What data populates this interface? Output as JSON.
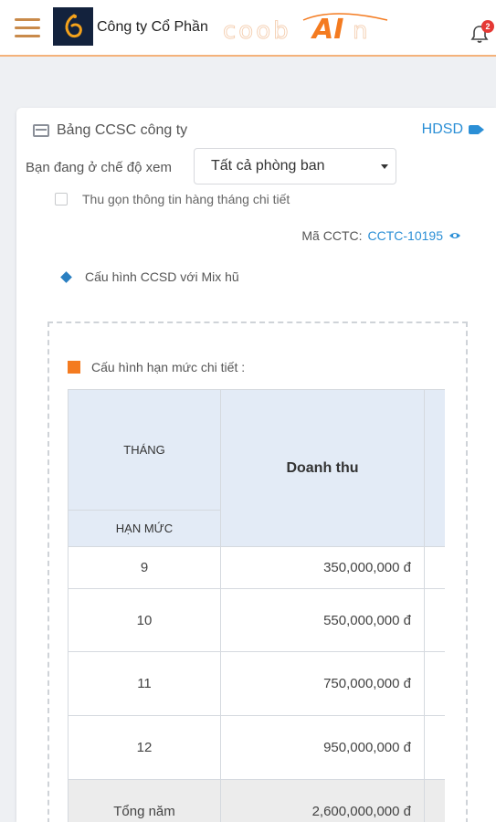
{
  "header": {
    "company_name": "Công ty Cổ Phần",
    "brand_text": "COOBAI",
    "notification_count": "2",
    "accent": "#f47b20"
  },
  "card": {
    "title": "Bảng CCSC công ty",
    "help_link": "HDSD",
    "view_mode_label": "Bạn đang ở chế độ xem",
    "department_select": "Tất cả phòng ban",
    "collapse_label": "Thu gọn thông tin hàng tháng chi tiết",
    "ma_cctc_label": "Mã CCTC:",
    "ma_cctc_value": "CCTC-10195",
    "mix_label": "Cấu hình CCSD với Mix hũ",
    "limit_label": "Cấu hình hạn mức chi tiết :"
  },
  "table": {
    "col_month": "THÁNG",
    "col_limit": "HẠN MỨC",
    "col_revenue": "Doanh thu",
    "rows": [
      {
        "month": "9",
        "revenue": "350,000,000 đ"
      },
      {
        "month": "10",
        "revenue": "550,000,000 đ"
      },
      {
        "month": "11",
        "revenue": "750,000,000 đ"
      },
      {
        "month": "12",
        "revenue": "950,000,000 đ"
      }
    ],
    "total_label": "Tổng năm",
    "total_value": "2,600,000,000 đ"
  }
}
